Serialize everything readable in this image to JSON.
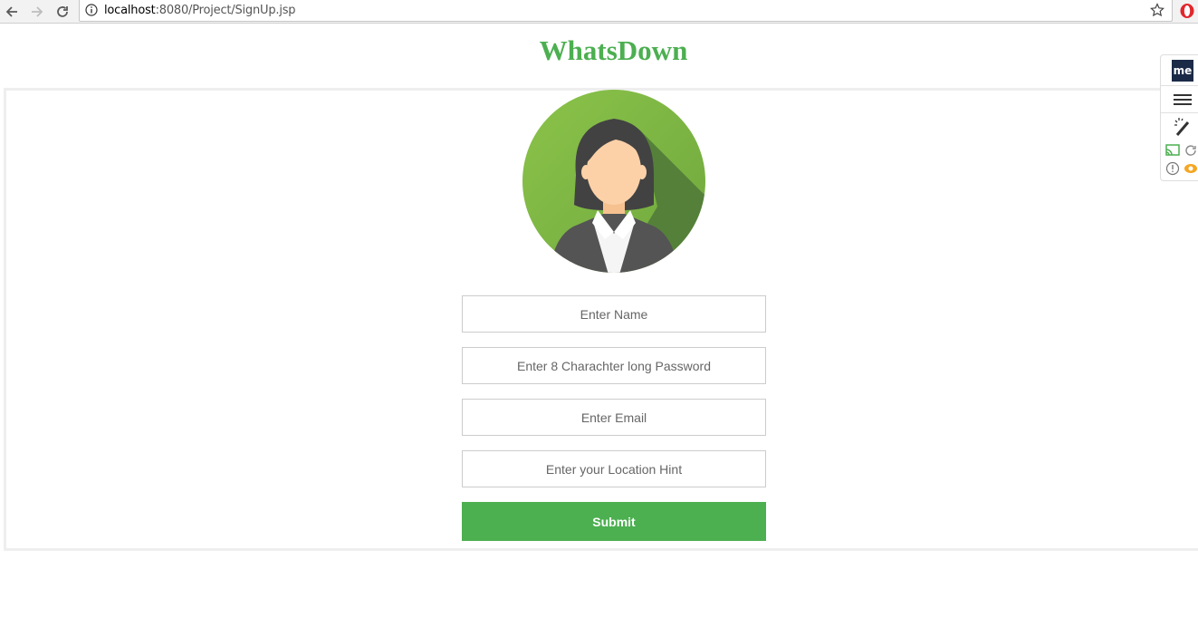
{
  "browser": {
    "url_host": "localhost",
    "url_rest": ":8080/Project/SignUp.jsp"
  },
  "page": {
    "brand": "WhatsDown"
  },
  "form": {
    "name_placeholder": "Enter Name",
    "password_placeholder": "Enter 8 Charachter long Password",
    "email_placeholder": "Enter Email",
    "location_placeholder": "Enter your Location Hint",
    "submit_label": "Submit"
  },
  "extension": {
    "logo_text": "me"
  },
  "colors": {
    "brand": "#4caf50",
    "submit_bg": "#4caf50"
  },
  "icons": [
    "back-icon",
    "forward-icon",
    "reload-icon",
    "info-icon",
    "star-icon",
    "opera-icon",
    "hamburger-icon",
    "magic-wand-icon",
    "cast-icon",
    "refresh-icon",
    "alert-icon",
    "eye-icon"
  ]
}
